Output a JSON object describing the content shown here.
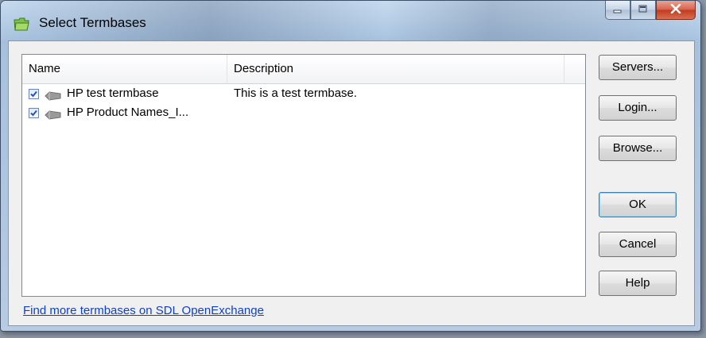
{
  "window": {
    "title": "Select Termbases"
  },
  "list": {
    "columns": {
      "name": "Name",
      "description": "Description"
    },
    "rows": [
      {
        "name": "HP test termbase",
        "description": "This is a test termbase.",
        "checked": true
      },
      {
        "name": "HP Product Names_I...",
        "description": "",
        "checked": true
      }
    ]
  },
  "buttons": {
    "servers": "Servers...",
    "login": "Login...",
    "browse": "Browse...",
    "ok": "OK",
    "cancel": "Cancel",
    "help": "Help"
  },
  "link": {
    "openexchange": "Find more termbases on SDL OpenExchange"
  },
  "colors": {
    "link": "#0f40cc",
    "close_button": "#c2391f",
    "default_button_border": "#3c7fb1"
  },
  "icons": {
    "app": "termbase-folder-icon",
    "row": "termbase-icon"
  }
}
